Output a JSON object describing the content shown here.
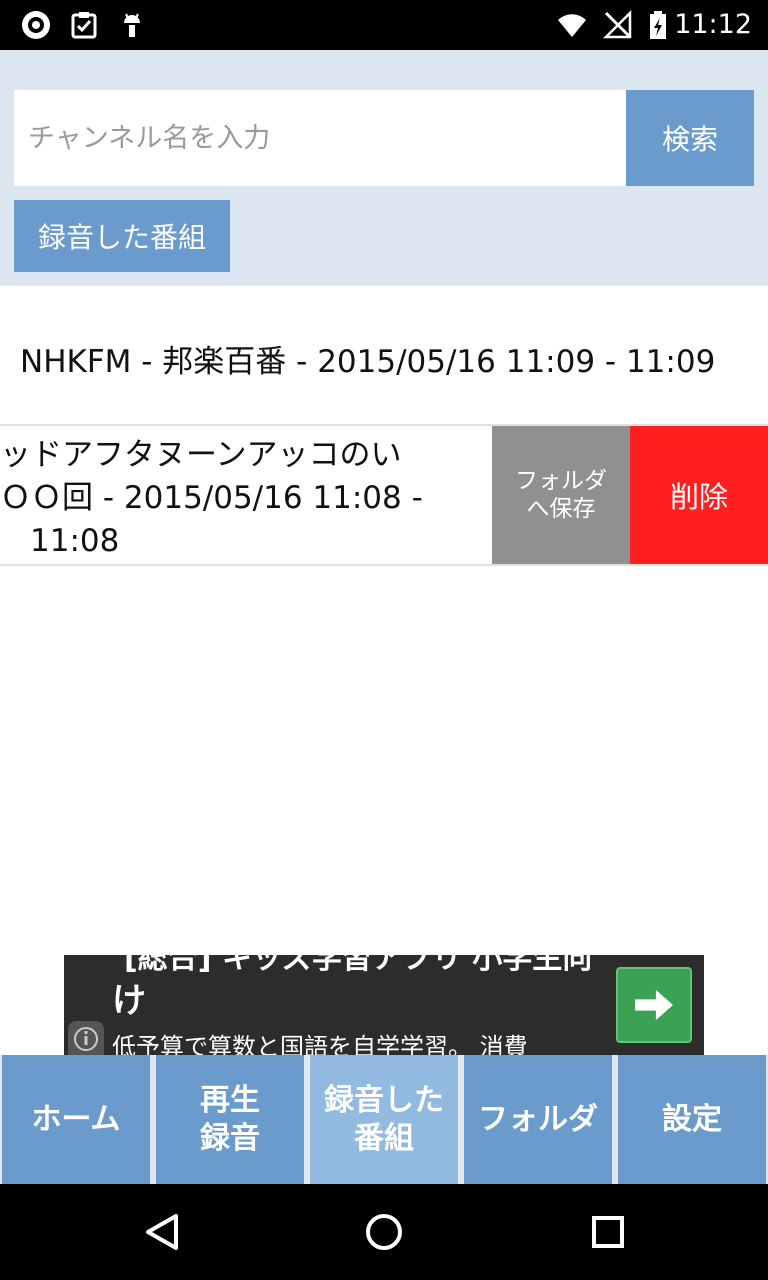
{
  "status_bar": {
    "time": "11:12",
    "left_icons": [
      "app-icon",
      "clipboard-check-icon",
      "android-icon"
    ],
    "right_icons": [
      "wifi-icon",
      "no-signal-icon",
      "battery-charging-icon"
    ]
  },
  "search": {
    "placeholder": "チャンネル名を入力",
    "value": "",
    "button_label": "検索"
  },
  "recorded_button_label": "録音した番組",
  "list": [
    {
      "text": "NHKFM - 邦楽百番 - 2015/05/16 11:09 - 11:09"
    },
    {
      "line1": "ッドアフタヌーンアッコのい",
      "line2": "ＯＯ回 - 2015/05/16 11:08 -",
      "line3": "11:08",
      "folder_save_label": "フォルダ\nへ保存",
      "delete_label": "削除"
    }
  ],
  "ad": {
    "top_text": "[総合] キッズ学習アプリ 小学生向",
    "title": "け",
    "description": "低予算で算数と国語を自学学習。 消費",
    "arrow_icon": "arrow-right-icon"
  },
  "tabs": [
    {
      "label": "ホーム",
      "active": false
    },
    {
      "label": "再生\n録音",
      "active": false
    },
    {
      "label": "録音した\n番組",
      "active": true
    },
    {
      "label": "フォルダ",
      "active": false
    },
    {
      "label": "設定",
      "active": false
    }
  ],
  "colors": {
    "accent": "#6a9bcc",
    "active_tab": "#92b9e0",
    "delete": "#ff1f1f",
    "folder_save": "#909090",
    "header_bg": "#dce6f1"
  }
}
